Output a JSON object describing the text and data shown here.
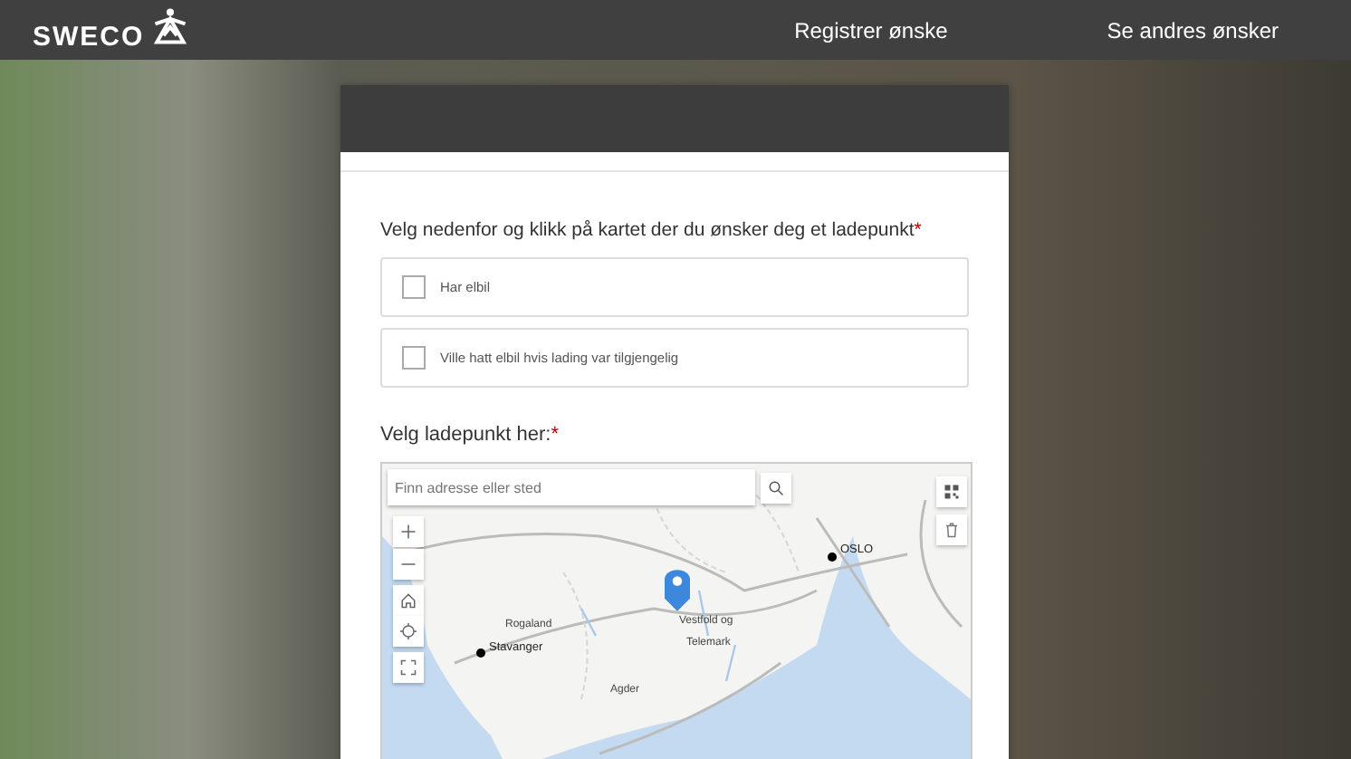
{
  "header": {
    "logo": "SWECO",
    "nav": [
      {
        "label": "Registrer ønske",
        "selected": false
      },
      {
        "label": "Se andres ønsker",
        "selected": false
      }
    ]
  },
  "form": {
    "question": "Velg nedenfor og klikk på kartet der du ønsker deg et ladepunkt",
    "question_required": "*",
    "options": [
      {
        "label": "Har elbil",
        "checked": false
      },
      {
        "label": "Ville hatt elbil hvis lading var tilgjengelig",
        "checked": false
      }
    ],
    "map_label": "Velg ladepunkt her:",
    "map_required": "*",
    "map": {
      "search": {
        "placeholder": "Finn adresse eller sted"
      },
      "places": [
        {
          "name": "OSLO",
          "kind": "city"
        },
        {
          "name": "Rogaland",
          "kind": "region"
        },
        {
          "name": "Stavanger",
          "kind": "city"
        },
        {
          "name": "Vestfold og",
          "kind": "region"
        },
        {
          "name": "Telemark",
          "kind": "region"
        },
        {
          "name": "Agder",
          "kind": "region"
        }
      ]
    }
  }
}
